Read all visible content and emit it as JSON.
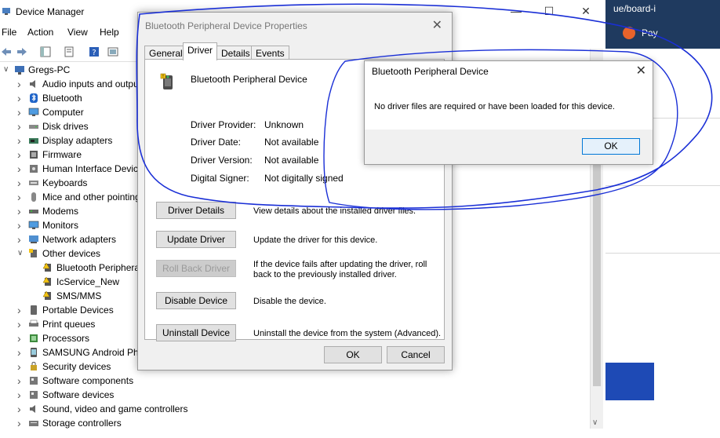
{
  "device_manager": {
    "title": "Device Manager",
    "menus": [
      "File",
      "Action",
      "View",
      "Help"
    ],
    "tree": [
      {
        "label": "Gregs-PC",
        "indent": 0,
        "expander": "expanded",
        "icon": "computer-icon"
      },
      {
        "label": "Audio inputs and outputs",
        "indent": 1,
        "expander": "collapsed",
        "icon": "speaker-icon"
      },
      {
        "label": "Bluetooth",
        "indent": 1,
        "expander": "collapsed",
        "icon": "bluetooth-icon"
      },
      {
        "label": "Computer",
        "indent": 1,
        "expander": "collapsed",
        "icon": "monitor-icon"
      },
      {
        "label": "Disk drives",
        "indent": 1,
        "expander": "collapsed",
        "icon": "disk-icon"
      },
      {
        "label": "Display adapters",
        "indent": 1,
        "expander": "collapsed",
        "icon": "display-adapter-icon"
      },
      {
        "label": "Firmware",
        "indent": 1,
        "expander": "collapsed",
        "icon": "firmware-icon"
      },
      {
        "label": "Human Interface Devices",
        "indent": 1,
        "expander": "collapsed",
        "icon": "hid-icon"
      },
      {
        "label": "Keyboards",
        "indent": 1,
        "expander": "collapsed",
        "icon": "keyboard-icon"
      },
      {
        "label": "Mice and other pointing devices",
        "indent": 1,
        "expander": "collapsed",
        "icon": "mouse-icon"
      },
      {
        "label": "Modems",
        "indent": 1,
        "expander": "collapsed",
        "icon": "modem-icon"
      },
      {
        "label": "Monitors",
        "indent": 1,
        "expander": "collapsed",
        "icon": "monitor-icon"
      },
      {
        "label": "Network adapters",
        "indent": 1,
        "expander": "collapsed",
        "icon": "network-icon"
      },
      {
        "label": "Other devices",
        "indent": 1,
        "expander": "expanded",
        "icon": "unknown-device-icon"
      },
      {
        "label": "Bluetooth Peripheral Device",
        "indent": 2,
        "expander": "none",
        "icon": "warning-device-icon"
      },
      {
        "label": "IcService_New",
        "indent": 2,
        "expander": "none",
        "icon": "warning-device-icon"
      },
      {
        "label": "SMS/MMS",
        "indent": 2,
        "expander": "none",
        "icon": "warning-device-icon"
      },
      {
        "label": "Portable Devices",
        "indent": 1,
        "expander": "collapsed",
        "icon": "portable-device-icon"
      },
      {
        "label": "Print queues",
        "indent": 1,
        "expander": "collapsed",
        "icon": "printer-icon"
      },
      {
        "label": "Processors",
        "indent": 1,
        "expander": "collapsed",
        "icon": "processor-icon"
      },
      {
        "label": "SAMSUNG Android Phone",
        "indent": 1,
        "expander": "collapsed",
        "icon": "phone-icon"
      },
      {
        "label": "Security devices",
        "indent": 1,
        "expander": "collapsed",
        "icon": "security-icon"
      },
      {
        "label": "Software components",
        "indent": 1,
        "expander": "collapsed",
        "icon": "software-icon"
      },
      {
        "label": "Software devices",
        "indent": 1,
        "expander": "collapsed",
        "icon": "software-icon"
      },
      {
        "label": "Sound, video and game controllers",
        "indent": 1,
        "expander": "collapsed",
        "icon": "speaker-icon"
      },
      {
        "label": "Storage controllers",
        "indent": 1,
        "expander": "collapsed",
        "icon": "storage-icon"
      }
    ]
  },
  "browser": {
    "tab_text": "ue/board-i",
    "button_text": "Pay"
  },
  "properties_dialog": {
    "title": "Bluetooth Peripheral Device Properties",
    "tabs": [
      "General",
      "Driver",
      "Details",
      "Events"
    ],
    "active_tab": "Driver",
    "device_name": "Bluetooth Peripheral Device",
    "props": [
      {
        "label": "Driver Provider:",
        "value": "Unknown"
      },
      {
        "label": "Driver Date:",
        "value": "Not available"
      },
      {
        "label": "Driver Version:",
        "value": "Not available"
      },
      {
        "label": "Digital Signer:",
        "value": "Not digitally signed"
      }
    ],
    "buttons": [
      {
        "label": "Driver Details",
        "desc": "View details about the installed driver files.",
        "enabled": true
      },
      {
        "label": "Update Driver",
        "desc": "Update the driver for this device.",
        "enabled": true
      },
      {
        "label": "Roll Back Driver",
        "desc": "If the device fails after updating the driver, roll back to the previously installed driver.",
        "enabled": false
      },
      {
        "label": "Disable Device",
        "desc": "Disable the device.",
        "enabled": true
      },
      {
        "label": "Uninstall Device",
        "desc": "Uninstall the device from the system (Advanced).",
        "enabled": true
      }
    ],
    "ok_label": "OK",
    "cancel_label": "Cancel"
  },
  "message_box": {
    "title": "Bluetooth Peripheral Device",
    "text": "No driver files are required or have been loaded for this device.",
    "ok_label": "OK"
  },
  "annotation_color": "#1a2fd6"
}
